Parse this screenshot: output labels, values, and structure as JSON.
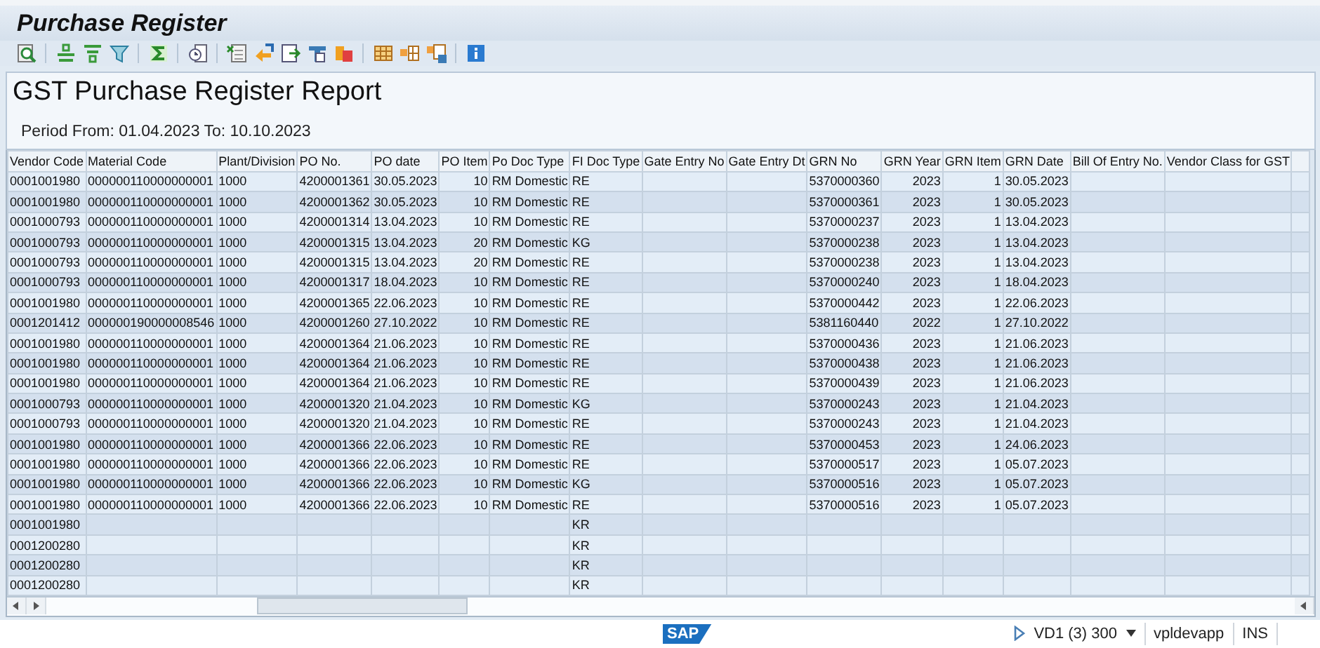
{
  "window": {
    "title": "Purchase Register"
  },
  "report": {
    "title": "GST Purchase Register Report",
    "period": "Period From: 01.04.2023 To: 10.10.2023"
  },
  "table": {
    "columns": [
      "Vendor Code",
      "Material Code",
      "Plant/Division",
      "PO No.",
      "PO date",
      "PO Item",
      "Po Doc Type",
      "FI Doc Type",
      "Gate Entry No",
      "Gate Entry Dt",
      "GRN No",
      "GRN Year",
      "GRN Item",
      "GRN Date",
      "Bill Of Entry No.",
      "Vendor Class for GST"
    ],
    "rows": [
      [
        "0001001980",
        "000000110000000001",
        "1000",
        "4200001361",
        "30.05.2023",
        "10",
        "RM Domestic",
        "RE",
        null,
        null,
        "5370000360",
        "2023",
        "1",
        "30.05.2023"
      ],
      [
        "0001001980",
        "000000110000000001",
        "1000",
        "4200001362",
        "30.05.2023",
        "10",
        "RM Domestic",
        "RE",
        null,
        null,
        "5370000361",
        "2023",
        "1",
        "30.05.2023"
      ],
      [
        "0001000793",
        "000000110000000001",
        "1000",
        "4200001314",
        "13.04.2023",
        "10",
        "RM Domestic",
        "RE",
        null,
        null,
        "5370000237",
        "2023",
        "1",
        "13.04.2023"
      ],
      [
        "0001000793",
        "000000110000000001",
        "1000",
        "4200001315",
        "13.04.2023",
        "20",
        "RM Domestic",
        "KG",
        null,
        null,
        "5370000238",
        "2023",
        "1",
        "13.04.2023"
      ],
      [
        "0001000793",
        "000000110000000001",
        "1000",
        "4200001315",
        "13.04.2023",
        "20",
        "RM Domestic",
        "RE",
        null,
        null,
        "5370000238",
        "2023",
        "1",
        "13.04.2023"
      ],
      [
        "0001000793",
        "000000110000000001",
        "1000",
        "4200001317",
        "18.04.2023",
        "10",
        "RM Domestic",
        "RE",
        null,
        null,
        "5370000240",
        "2023",
        "1",
        "18.04.2023"
      ],
      [
        "0001001980",
        "000000110000000001",
        "1000",
        "4200001365",
        "22.06.2023",
        "10",
        "RM Domestic",
        "RE",
        null,
        null,
        "5370000442",
        "2023",
        "1",
        "22.06.2023"
      ],
      [
        "0001201412",
        "000000190000008546",
        "1000",
        "4200001260",
        "27.10.2022",
        "10",
        "RM Domestic",
        "RE",
        null,
        null,
        "5381160440",
        "2022",
        "1",
        "27.10.2022"
      ],
      [
        "0001001980",
        "000000110000000001",
        "1000",
        "4200001364",
        "21.06.2023",
        "10",
        "RM Domestic",
        "RE",
        null,
        null,
        "5370000436",
        "2023",
        "1",
        "21.06.2023"
      ],
      [
        "0001001980",
        "000000110000000001",
        "1000",
        "4200001364",
        "21.06.2023",
        "10",
        "RM Domestic",
        "RE",
        null,
        null,
        "5370000438",
        "2023",
        "1",
        "21.06.2023"
      ],
      [
        "0001001980",
        "000000110000000001",
        "1000",
        "4200001364",
        "21.06.2023",
        "10",
        "RM Domestic",
        "RE",
        null,
        null,
        "5370000439",
        "2023",
        "1",
        "21.06.2023"
      ],
      [
        "0001000793",
        "000000110000000001",
        "1000",
        "4200001320",
        "21.04.2023",
        "10",
        "RM Domestic",
        "KG",
        null,
        null,
        "5370000243",
        "2023",
        "1",
        "21.04.2023"
      ],
      [
        "0001000793",
        "000000110000000001",
        "1000",
        "4200001320",
        "21.04.2023",
        "10",
        "RM Domestic",
        "RE",
        null,
        null,
        "5370000243",
        "2023",
        "1",
        "21.04.2023"
      ],
      [
        "0001001980",
        "000000110000000001",
        "1000",
        "4200001366",
        "22.06.2023",
        "10",
        "RM Domestic",
        "RE",
        null,
        null,
        "5370000453",
        "2023",
        "1",
        "24.06.2023"
      ],
      [
        "0001001980",
        "000000110000000001",
        "1000",
        "4200001366",
        "22.06.2023",
        "10",
        "RM Domestic",
        "RE",
        null,
        null,
        "5370000517",
        "2023",
        "1",
        "05.07.2023"
      ],
      [
        "0001001980",
        "000000110000000001",
        "1000",
        "4200001366",
        "22.06.2023",
        "10",
        "RM Domestic",
        "KG",
        null,
        null,
        "5370000516",
        "2023",
        "1",
        "05.07.2023"
      ],
      [
        "0001001980",
        "000000110000000001",
        "1000",
        "4200001366",
        "22.06.2023",
        "10",
        "RM Domestic",
        "RE",
        null,
        null,
        "5370000516",
        "2023",
        "1",
        "05.07.2023"
      ],
      [
        "0001001980",
        null,
        null,
        null,
        null,
        null,
        null,
        "KR"
      ],
      [
        "0001200280",
        null,
        null,
        null,
        null,
        null,
        null,
        "KR"
      ],
      [
        "0001200280",
        null,
        null,
        null,
        null,
        null,
        null,
        "KR"
      ],
      [
        "0001200280",
        null,
        null,
        null,
        null,
        null,
        null,
        "KR"
      ]
    ]
  },
  "status_bar": {
    "logo": "SAP",
    "system": "VD1 (3) 300",
    "server": "vpldevapp",
    "mode": "INS"
  }
}
